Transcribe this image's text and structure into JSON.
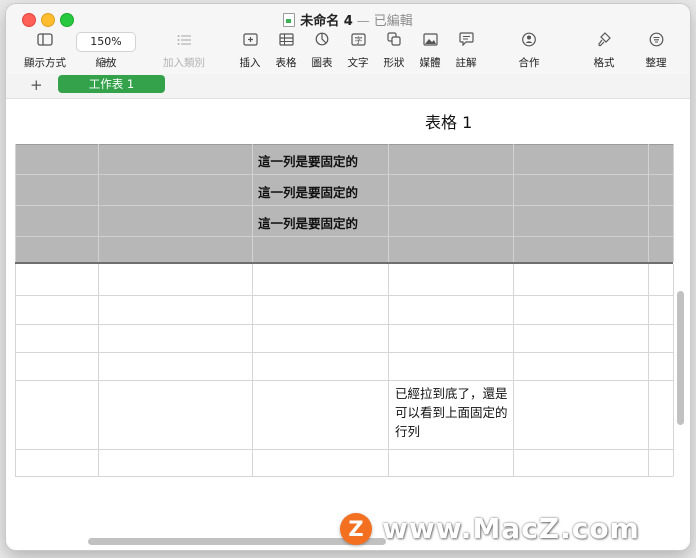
{
  "window": {
    "title": "未命名 4",
    "title_separator": "—",
    "status": "已編輯"
  },
  "toolbar": {
    "view": {
      "label": "顯示方式",
      "icon": "sidebar-icon"
    },
    "zoom": {
      "label": "縮放",
      "value": "150%",
      "chevron": "⌄"
    },
    "add_category": {
      "label": "加入類別",
      "icon": "list-icon",
      "enabled": false
    },
    "insert": {
      "label": "插入",
      "icon": "plus-box-icon"
    },
    "table": {
      "label": "表格",
      "icon": "table-icon"
    },
    "chart": {
      "label": "圖表",
      "icon": "pie-chart-icon"
    },
    "text": {
      "label": "文字",
      "icon": "text-box-icon"
    },
    "shape": {
      "label": "形狀",
      "icon": "shape-icon"
    },
    "media": {
      "label": "媒體",
      "icon": "photo-icon"
    },
    "comment": {
      "label": "註解",
      "icon": "comment-icon"
    },
    "collaborate": {
      "label": "合作",
      "icon": "collaborate-icon"
    },
    "format": {
      "label": "格式",
      "icon": "paintbrush-icon"
    },
    "organize": {
      "label": "整理",
      "icon": "organize-icon"
    }
  },
  "sheets": {
    "add_label": "+",
    "tabs": [
      {
        "label": "工作表 1",
        "active": true
      }
    ]
  },
  "table": {
    "title": "表格 1",
    "header_rows": [
      "這一列是要固定的",
      "這一列是要固定的",
      "這一列是要固定的"
    ],
    "note": "已經拉到底了，還是可以看到上面固定的行列",
    "header_color": "#b7b7b7"
  },
  "watermark": {
    "logo_letter": "Z",
    "text": "www.MacZ.com",
    "logo_color": "#f37021"
  }
}
